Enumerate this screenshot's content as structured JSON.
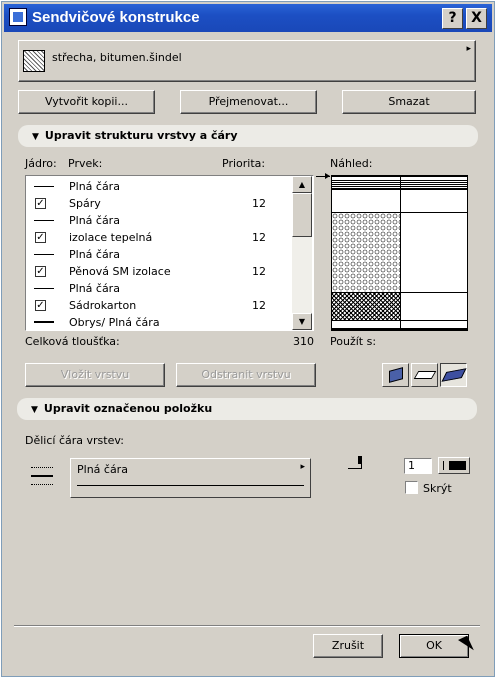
{
  "window": {
    "title": "Sendvičové konstrukce",
    "help_label": "?",
    "close_label": "X"
  },
  "selector": {
    "name": "střecha, bitumen.šindel",
    "arrow": "▸"
  },
  "toolbar": {
    "copy_label": "Vytvořit kopii...",
    "rename_label": "Přejmenovat...",
    "delete_label": "Smazat"
  },
  "structure_panel": {
    "title": "Upravit strukturu vrstvy a čáry",
    "col_core": "Jádro:",
    "col_element": "Prvek:",
    "col_priority": "Priorita:",
    "col_preview": "Náhled:",
    "rows": [
      {
        "type": "line",
        "name": "Plná čára",
        "priority": ""
      },
      {
        "type": "check",
        "name": "Spáry",
        "priority": "12"
      },
      {
        "type": "line",
        "name": "Plná čára",
        "priority": ""
      },
      {
        "type": "check",
        "name": "izolace tepelná",
        "priority": "12"
      },
      {
        "type": "line",
        "name": "Plná čára",
        "priority": ""
      },
      {
        "type": "check",
        "name": "Pěnová SM izolace",
        "priority": "12"
      },
      {
        "type": "line",
        "name": "Plná čára",
        "priority": ""
      },
      {
        "type": "check",
        "name": "Sádrokarton",
        "priority": "12"
      },
      {
        "type": "line-bold",
        "name": "Obrys/  Plná čára",
        "priority": ""
      }
    ],
    "total_label": "Celková tloušťka:",
    "total_value": "310",
    "use_with_label": "Použít s:",
    "insert_label": "Vložit vrstvu",
    "remove_label": "Odstranit vrstvu"
  },
  "item_panel": {
    "title": "Upravit označenou položku",
    "divider_label": "Dělicí čára vrstev:",
    "line_type": "Plná čára",
    "pen_value": "1",
    "hide_label": "Skrýt"
  },
  "footer": {
    "cancel_label": "Zrušit",
    "ok_label": "OK"
  }
}
